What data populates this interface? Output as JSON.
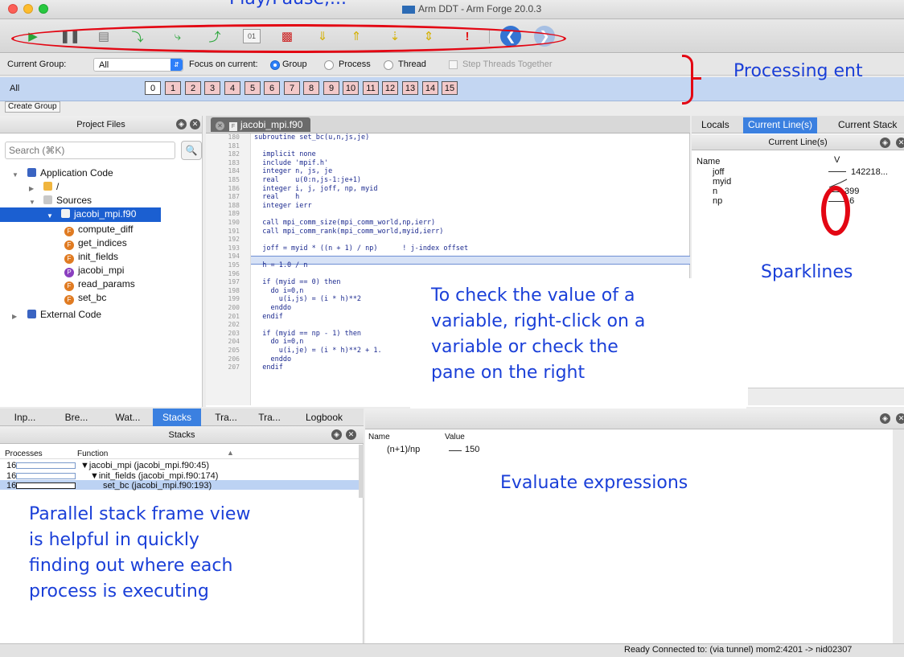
{
  "window": {
    "title": "Arm DDT - Arm Forge 20.0.3"
  },
  "annotations": {
    "top_clip": "Play/Pause,...",
    "processing": "Processing ent",
    "sparklines": "Sparklines",
    "check_value": [
      "To check the value of a",
      "variable, right-click on a",
      "variable or check the",
      "pane on the right"
    ],
    "evaluate": "Evaluate expressions",
    "parallel": [
      "Parallel stack frame view",
      "is helpful in quickly",
      "finding out where each",
      "process is executing"
    ]
  },
  "groupbar": {
    "current_group_label": "Current Group:",
    "current_group_value": "All",
    "focus_label": "Focus on current:",
    "focus_options": [
      "Group",
      "Process",
      "Thread"
    ],
    "step_threads": "Step Threads Together"
  },
  "allbar": {
    "label": "All",
    "processes": [
      "0",
      "1",
      "2",
      "3",
      "4",
      "5",
      "6",
      "7",
      "8",
      "9",
      "10",
      "11",
      "12",
      "13",
      "14",
      "15"
    ],
    "create_group": "Create Group"
  },
  "project_files": {
    "title": "Project Files",
    "search_placeholder": "Search (⌘K)",
    "tree": {
      "application_code": "Application Code",
      "root_folder": "/",
      "sources": "Sources",
      "file": "jacobi_mpi.f90",
      "functions": [
        "compute_diff",
        "get_indices",
        "init_fields",
        "jacobi_mpi",
        "read_params",
        "set_bc"
      ],
      "external_code": "External Code"
    }
  },
  "editor": {
    "tab": "jacobi_mpi.f90",
    "lines": [
      {
        "n": "180",
        "t": "subroutine set_bc(u,n,js,je)"
      },
      {
        "n": "181",
        "t": ""
      },
      {
        "n": "182",
        "t": "  implicit none"
      },
      {
        "n": "183",
        "t": "  include 'mpif.h'"
      },
      {
        "n": "184",
        "t": "  integer n, js, je"
      },
      {
        "n": "185",
        "t": "  real    u(0:n,js-1:je+1)"
      },
      {
        "n": "186",
        "t": "  integer i, j, joff, np, myid"
      },
      {
        "n": "187",
        "t": "  real    h"
      },
      {
        "n": "188",
        "t": "  integer ierr"
      },
      {
        "n": "189",
        "t": ""
      },
      {
        "n": "190",
        "t": "  call mpi_comm_size(mpi_comm_world,np,ierr)"
      },
      {
        "n": "191",
        "t": "  call mpi_comm_rank(mpi_comm_world,myid,ierr)"
      },
      {
        "n": "192",
        "t": ""
      },
      {
        "n": "193",
        "t": "  joff = myid * ((n + 1) / np)      ! j-index offset"
      },
      {
        "n": "194",
        "t": ""
      },
      {
        "n": "195",
        "t": "  h = 1.0 / n"
      },
      {
        "n": "196",
        "t": ""
      },
      {
        "n": "197",
        "t": "  if (myid == 0) then"
      },
      {
        "n": "198",
        "t": "    do i=0,n"
      },
      {
        "n": "199",
        "t": "      u(i,js) = (i * h)**2"
      },
      {
        "n": "200",
        "t": "    enddo"
      },
      {
        "n": "201",
        "t": "  endif"
      },
      {
        "n": "202",
        "t": ""
      },
      {
        "n": "203",
        "t": "  if (myid == np - 1) then"
      },
      {
        "n": "204",
        "t": "    do i=0,n"
      },
      {
        "n": "205",
        "t": "      u(i,je) = (i * h)**2 + 1."
      },
      {
        "n": "206",
        "t": "    enddo"
      },
      {
        "n": "207",
        "t": "  endif"
      }
    ]
  },
  "right_pane": {
    "tabs": [
      "Locals",
      "Current Line(s)",
      "Current Stack"
    ],
    "header": "Current Line(s)",
    "col_name": "Name",
    "col_value": "V",
    "vars": [
      {
        "name": "joff",
        "value": "142218..."
      },
      {
        "name": "myid",
        "value": ""
      },
      {
        "name": "n",
        "value": "399"
      },
      {
        "name": "np",
        "value": "16"
      }
    ]
  },
  "stacks": {
    "tabs": [
      "Inp...",
      "Bre...",
      "Wat...",
      "Stacks",
      "Tra...",
      "Tra...",
      "Logbook"
    ],
    "title": "Stacks",
    "col_processes": "Processes",
    "col_function": "Function",
    "rows": [
      {
        "count": "16",
        "func": "▼jacobi_mpi (jacobi_mpi.f90:45)"
      },
      {
        "count": "16",
        "func": "▼init_fields (jacobi_mpi.f90:174)"
      },
      {
        "count": "16",
        "func": "set_bc (jacobi_mpi.f90:193)"
      }
    ]
  },
  "evaluate": {
    "col_name": "Name",
    "col_value": "Value",
    "rows": [
      {
        "name": "(n+1)/np",
        "value": "150"
      }
    ]
  },
  "status": "Ready  Connected to: (via tunnel) mom2:4201 -> nid02307"
}
